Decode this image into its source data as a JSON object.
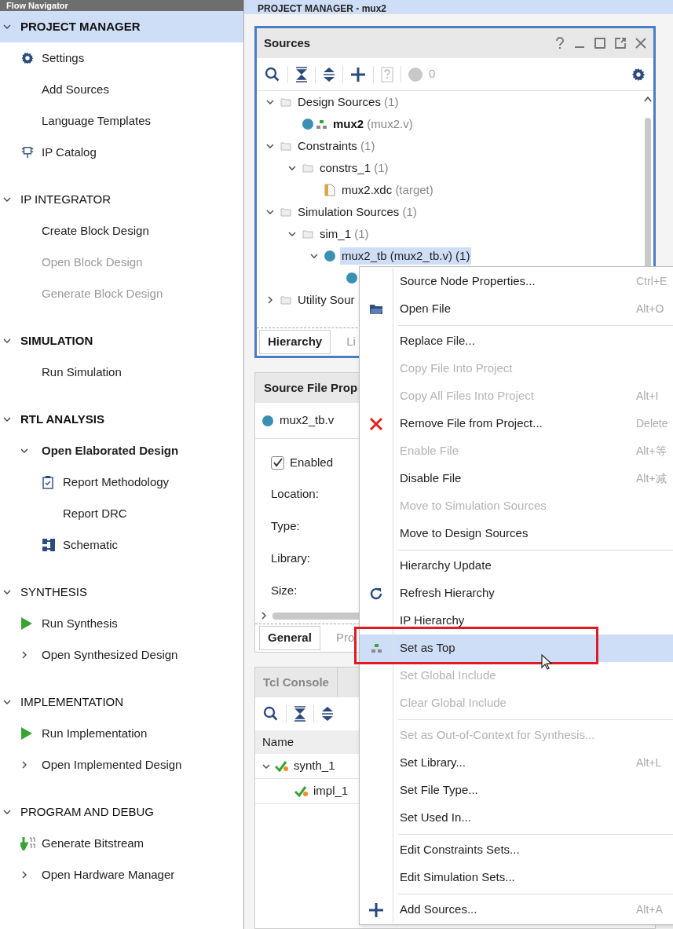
{
  "navigator": {
    "title": "Flow Navigator",
    "sections": [
      {
        "title": "PROJECT MANAGER",
        "expanded": true,
        "selected": true,
        "bold": true,
        "items": [
          {
            "label": "Settings",
            "kind": "gear",
            "disabled": false
          },
          {
            "label": "Add Sources",
            "disabled": false
          },
          {
            "label": "Language Templates",
            "disabled": false
          },
          {
            "label": "IP Catalog",
            "kind": "chip",
            "disabled": false
          }
        ]
      },
      {
        "title": "IP INTEGRATOR",
        "expanded": true,
        "selected": false,
        "bold": false,
        "items": [
          {
            "label": "Create Block Design",
            "disabled": false
          },
          {
            "label": "Open Block Design",
            "disabled": true
          },
          {
            "label": "Generate Block Design",
            "disabled": true
          }
        ]
      },
      {
        "title": "SIMULATION",
        "expanded": true,
        "selected": false,
        "bold": true,
        "items": [
          {
            "label": "Run Simulation",
            "disabled": false
          }
        ]
      },
      {
        "title": "RTL ANALYSIS",
        "expanded": true,
        "selected": false,
        "bold": true,
        "items": [
          {
            "label": "Open Elaborated Design",
            "disabled": false,
            "expanded": true,
            "bold": true,
            "children": [
              {
                "label": "Report Methodology",
                "kind": "clipboard",
                "disabled": false
              },
              {
                "label": "Report DRC",
                "disabled": false
              },
              {
                "label": "Schematic",
                "kind": "schematic",
                "disabled": false
              }
            ]
          }
        ]
      },
      {
        "title": "SYNTHESIS",
        "expanded": true,
        "selected": false,
        "bold": false,
        "items": [
          {
            "label": "Run Synthesis",
            "kind": "play",
            "disabled": false
          },
          {
            "label": "Open Synthesized Design",
            "disabled": false,
            "expanded": false,
            "bold": false
          }
        ]
      },
      {
        "title": "IMPLEMENTATION",
        "expanded": true,
        "selected": false,
        "bold": false,
        "items": [
          {
            "label": "Run Implementation",
            "kind": "play",
            "disabled": false
          },
          {
            "label": "Open Implemented Design",
            "disabled": false,
            "expanded": false,
            "bold": false
          }
        ]
      },
      {
        "title": "PROGRAM AND DEBUG",
        "expanded": true,
        "selected": false,
        "bold": false,
        "items": [
          {
            "label": "Generate Bitstream",
            "kind": "bitstream",
            "disabled": false
          },
          {
            "label": "Open Hardware Manager",
            "disabled": false,
            "expanded": false,
            "bold": false
          }
        ]
      }
    ]
  },
  "main_title": "PROJECT MANAGER - mux2",
  "sources": {
    "title": "Sources",
    "count": "0",
    "tree": [
      {
        "label": "Design Sources",
        "detail": "(1)",
        "kind": "folder",
        "expanded": true,
        "selected": false,
        "children": [
          {
            "label": "mux2",
            "detail": "(mux2.v)",
            "kind": "top",
            "bold": true,
            "selected": false
          }
        ]
      },
      {
        "label": "Constraints",
        "detail": "(1)",
        "kind": "folder",
        "expanded": true,
        "selected": false,
        "children": [
          {
            "label": "constrs_1",
            "detail": "(1)",
            "kind": "folder",
            "expanded": true,
            "selected": false,
            "children": [
              {
                "label": "mux2.xdc",
                "detail": "(target)",
                "kind": "xdc",
                "selected": false
              }
            ]
          }
        ]
      },
      {
        "label": "Simulation Sources",
        "detail": "(1)",
        "kind": "folder",
        "expanded": true,
        "selected": false,
        "children": [
          {
            "label": "sim_1",
            "detail": "(1)",
            "kind": "folder",
            "expanded": true,
            "selected": false,
            "children": [
              {
                "label": "mux2_tb (mux2_tb.v) (1)",
                "kind": "dot",
                "expanded": true,
                "selected": true,
                "children": [
                  {
                    "kind": "dot"
                  }
                ]
              }
            ]
          }
        ]
      },
      {
        "label": "Utility Sour",
        "kind": "folder",
        "expanded": false,
        "selected": false
      }
    ],
    "tabs": [
      {
        "label": "Hierarchy",
        "selected": true
      },
      {
        "label": "Li",
        "selected": false
      }
    ]
  },
  "properties": {
    "title": "Source File Prop",
    "file": "mux2_tb.v",
    "enabled_label": "Enabled",
    "enabled": true,
    "fields": [
      "Location:",
      "Type:",
      "Library:",
      "Size:"
    ],
    "tabs": [
      {
        "label": "General",
        "selected": true
      },
      {
        "label": "Pro",
        "selected": false
      }
    ]
  },
  "console": {
    "tabs": [
      {
        "label": "Tcl Console",
        "selected": false
      }
    ],
    "column": "Name",
    "runs": [
      {
        "label": "synth_1",
        "expanded": true,
        "children": [
          {
            "label": "impl_1"
          }
        ]
      }
    ]
  },
  "context_menu": [
    {
      "kind": "item",
      "label": "Source Node Properties...",
      "shortcut": "Ctrl+E",
      "disabled": false,
      "selected": false
    },
    {
      "kind": "folder",
      "label": "Open File",
      "shortcut": "Alt+O",
      "disabled": false,
      "selected": false
    },
    {
      "kind": "separator"
    },
    {
      "kind": "item",
      "label": "Replace File...",
      "disabled": false,
      "selected": false
    },
    {
      "kind": "item",
      "label": "Copy File Into Project",
      "disabled": true,
      "selected": false
    },
    {
      "kind": "item",
      "label": "Copy All Files Into Project",
      "shortcut": "Alt+I",
      "disabled": true,
      "selected": false
    },
    {
      "kind": "remove",
      "label": "Remove File from Project...",
      "shortcut": "Delete",
      "disabled": false,
      "selected": false
    },
    {
      "kind": "item",
      "label": "Enable File",
      "shortcut": "Alt+等",
      "disabled": true,
      "selected": false
    },
    {
      "kind": "item",
      "label": "Disable File",
      "shortcut": "Alt+减",
      "disabled": false,
      "selected": false
    },
    {
      "kind": "item",
      "label": "Move to Simulation Sources",
      "disabled": true,
      "selected": false
    },
    {
      "kind": "item",
      "label": "Move to Design Sources",
      "disabled": false,
      "selected": false
    },
    {
      "kind": "separator"
    },
    {
      "kind": "item",
      "label": "Hierarchy Update",
      "disabled": false,
      "selected": false
    },
    {
      "kind": "refresh",
      "label": "Refresh Hierarchy",
      "disabled": false,
      "selected": false
    },
    {
      "kind": "item",
      "label": "IP Hierarchy",
      "disabled": false,
      "selected": false
    },
    {
      "kind": "top",
      "label": "Set as Top",
      "disabled": false,
      "selected": true,
      "highlighted": true
    },
    {
      "kind": "item",
      "label": "Set Global Include",
      "disabled": true,
      "selected": false
    },
    {
      "kind": "item",
      "label": "Clear Global Include",
      "disabled": true,
      "selected": false
    },
    {
      "kind": "separator"
    },
    {
      "kind": "item",
      "label": "Set as Out-of-Context for Synthesis...",
      "disabled": true,
      "selected": false
    },
    {
      "kind": "item",
      "label": "Set Library...",
      "shortcut": "Alt+L",
      "disabled": false,
      "selected": false
    },
    {
      "kind": "item",
      "label": "Set File Type...",
      "disabled": false,
      "selected": false
    },
    {
      "kind": "item",
      "label": "Set Used In...",
      "disabled": false,
      "selected": false
    },
    {
      "kind": "separator"
    },
    {
      "kind": "item",
      "label": "Edit Constraints Sets...",
      "disabled": false,
      "selected": false
    },
    {
      "kind": "item",
      "label": "Edit Simulation Sets...",
      "disabled": false,
      "selected": false
    },
    {
      "kind": "separator"
    },
    {
      "kind": "plus",
      "label": "Add Sources...",
      "shortcut": "Alt+A",
      "disabled": false,
      "selected": false
    }
  ]
}
